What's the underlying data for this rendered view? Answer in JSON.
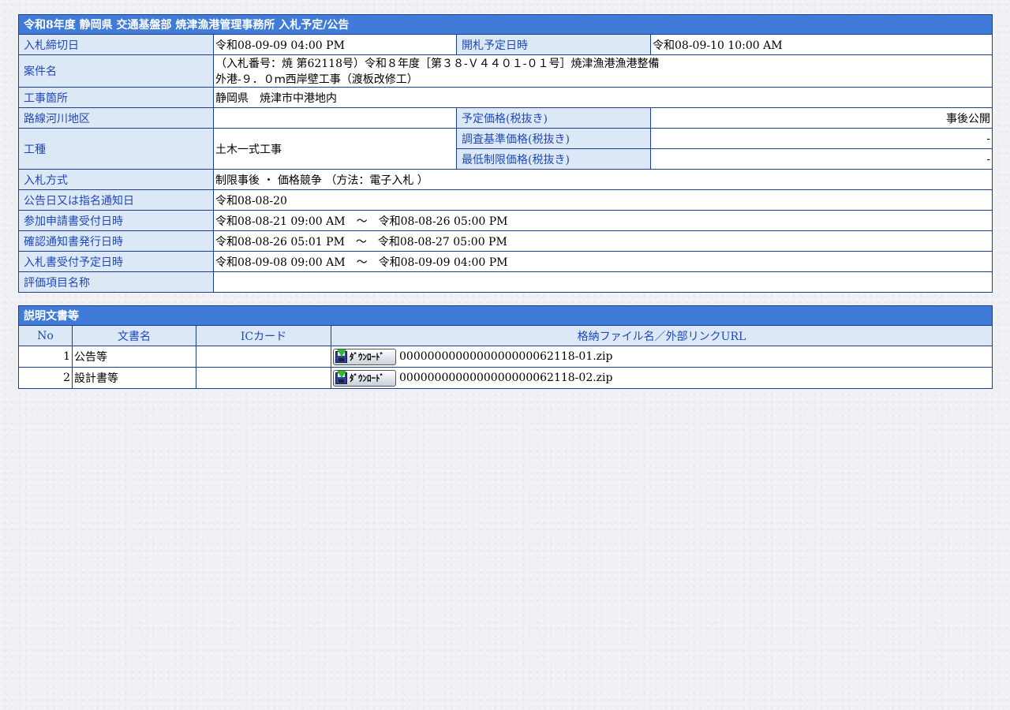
{
  "main": {
    "title": "令和8年度 静岡県 交通基盤部 焼津漁港管理事務所 入札予定/公告",
    "deadline_label": "入札締切日",
    "deadline_value": "令和08-09-09 04:00 PM",
    "opening_label": "開札予定日時",
    "opening_value": "令和08-09-10 10:00 AM",
    "case_label": "案件名",
    "case_value_line1": "（入札番号：焼 第62118号）令和８年度［第３８-Ｖ４４０１-０１号］焼津漁港漁港整備",
    "case_value_line2": "外港-９．０ｍ西岸壁工事（渡板改修工）",
    "location_label": "工事箇所",
    "location_value": "静岡県　焼津市中港地内",
    "route_label": "路線河川地区",
    "route_value": "",
    "planned_price_label": "予定価格(税抜き)",
    "planned_price_value": "事後公開",
    "work_type_label": "工種",
    "work_type_value": "土木一式工事",
    "survey_price_label": "調査基準価格(税抜き)",
    "survey_price_value": "-",
    "min_price_label": "最低制限価格(税抜き)",
    "min_price_value": "-",
    "bid_method_label": "入札方式",
    "bid_method_value": "制限事後 ・ 価格競争 （方法：電子入札 ）",
    "notice_label": "公告日又は指名通知日",
    "notice_value": "令和08-08-20",
    "application_label": "参加申請書受付日時",
    "application_value": "令和08-08-21 09:00 AM　～　令和08-08-26 05:00 PM",
    "confirmation_label": "確認通知書発行日時",
    "confirmation_value": "令和08-08-26 05:01 PM　～　令和08-08-27 05:00 PM",
    "bid_receipt_label": "入札書受付予定日時",
    "bid_receipt_value": "令和08-09-08 09:00 AM　～　令和08-09-09 04:00 PM",
    "evaluation_label": "評価項目名称",
    "evaluation_value": ""
  },
  "docs": {
    "title": "説明文書等",
    "col_no": "No",
    "col_name": "文書名",
    "col_ic": "ICカード",
    "col_file": "格納ファイル名／外部リンクURL",
    "download_label": "ﾀﾞｳﾝﾛｰﾄﾞ",
    "rows": [
      {
        "no": "1",
        "name": "公告等",
        "ic": "",
        "file": "0000000000000000000062118-01.zip"
      },
      {
        "no": "2",
        "name": "設計書等",
        "ic": "",
        "file": "0000000000000000000062118-02.zip"
      }
    ]
  }
}
